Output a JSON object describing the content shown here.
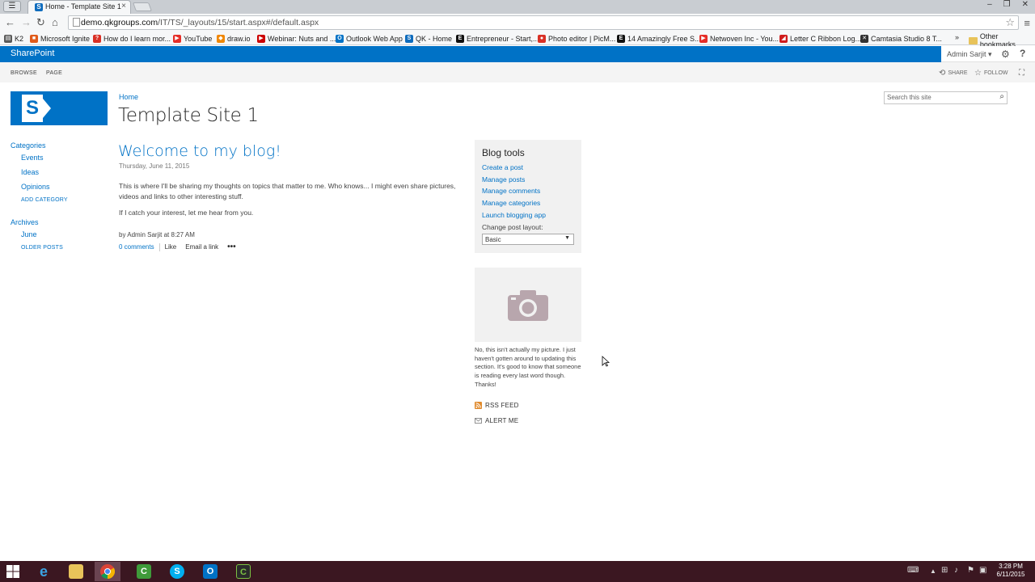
{
  "browser": {
    "tab_title": "Home - Template Site 1",
    "url_host": "demo.qkgroups.com",
    "url_path": "/IT/TS/_layouts/15/start.aspx#/default.aspx",
    "bookmarks": [
      {
        "label": "K2",
        "color": "#5a5a5a",
        "glyph": "▤"
      },
      {
        "label": "Microsoft Ignite",
        "color": "#e05a1a",
        "glyph": "■"
      },
      {
        "label": "How do I learn mor...",
        "color": "#d93025",
        "glyph": "?"
      },
      {
        "label": "YouTube",
        "color": "#e52d27",
        "glyph": "▶"
      },
      {
        "label": "draw.io",
        "color": "#f08705",
        "glyph": "◆"
      },
      {
        "label": "Webinar: Nuts and ...",
        "color": "#cc0000",
        "glyph": "▶"
      },
      {
        "label": "Outlook Web App",
        "color": "#0072c6",
        "glyph": "O"
      },
      {
        "label": "QK - Home",
        "color": "#0f6cbd",
        "glyph": "S"
      },
      {
        "label": "Entrepreneur - Start,...",
        "color": "#111111",
        "glyph": "E"
      },
      {
        "label": "Photo editor | PicM...",
        "color": "#d93025",
        "glyph": "●"
      },
      {
        "label": "14 Amazingly Free S...",
        "color": "#111111",
        "glyph": "E"
      },
      {
        "label": "Netwoven Inc - You...",
        "color": "#e52d27",
        "glyph": "▶"
      },
      {
        "label": "Letter C Ribbon Log...",
        "color": "#d01c1c",
        "glyph": "◢"
      },
      {
        "label": "Camtasia Studio 8 T...",
        "color": "#333333",
        "glyph": "✕"
      }
    ],
    "more": "»",
    "other_bookmarks": "Other bookmarks"
  },
  "suite": {
    "brand": "SharePoint",
    "user": "Admin Sarjit ▾",
    "help": "?"
  },
  "ribbon": {
    "tabs": [
      "BROWSE",
      "PAGE"
    ],
    "share": "SHARE",
    "follow": "FOLLOW"
  },
  "site": {
    "breadcrumb": "Home",
    "title": "Template Site 1",
    "search_placeholder": "Search this site"
  },
  "quicklaunch": {
    "categories_heading": "Categories",
    "categories": [
      "Events",
      "Ideas",
      "Opinions"
    ],
    "add_category": "ADD CATEGORY",
    "archives_heading": "Archives",
    "archives": [
      "June"
    ],
    "older_posts": "OLDER POSTS"
  },
  "post": {
    "title": "Welcome to my blog!",
    "date": "Thursday, June 11, 2015",
    "para1": "This is where I'll be sharing my thoughts on topics that matter to me. Who knows... I might even share pictures, videos and links to other interesting stuff.",
    "para2": "If I catch your interest, let me hear from you.",
    "by_prefix": "by",
    "author": "Admin Sarjit",
    "at_text": "at",
    "time": "8:27 AM",
    "comments": "0 comments",
    "like": "Like",
    "email": "Email a link",
    "more": "•••"
  },
  "blog_tools": {
    "heading": "Blog tools",
    "links": [
      "Create a post",
      "Manage posts",
      "Manage comments",
      "Manage categories",
      "Launch blogging app"
    ],
    "layout_label": "Change post layout:",
    "layout_value": "Basic"
  },
  "about": {
    "caption": "No, this isn't actually my picture. I just haven't gotten around to updating this section. It's good to know that someone is reading every last word though. Thanks!",
    "rss": "RSS FEED",
    "alert": "ALERT ME"
  },
  "taskbar": {
    "clock_time": "3:28 PM",
    "clock_date": "6/11/2015"
  },
  "colors": {
    "accent": "#0072c6",
    "taskbar": "#3b1721"
  }
}
